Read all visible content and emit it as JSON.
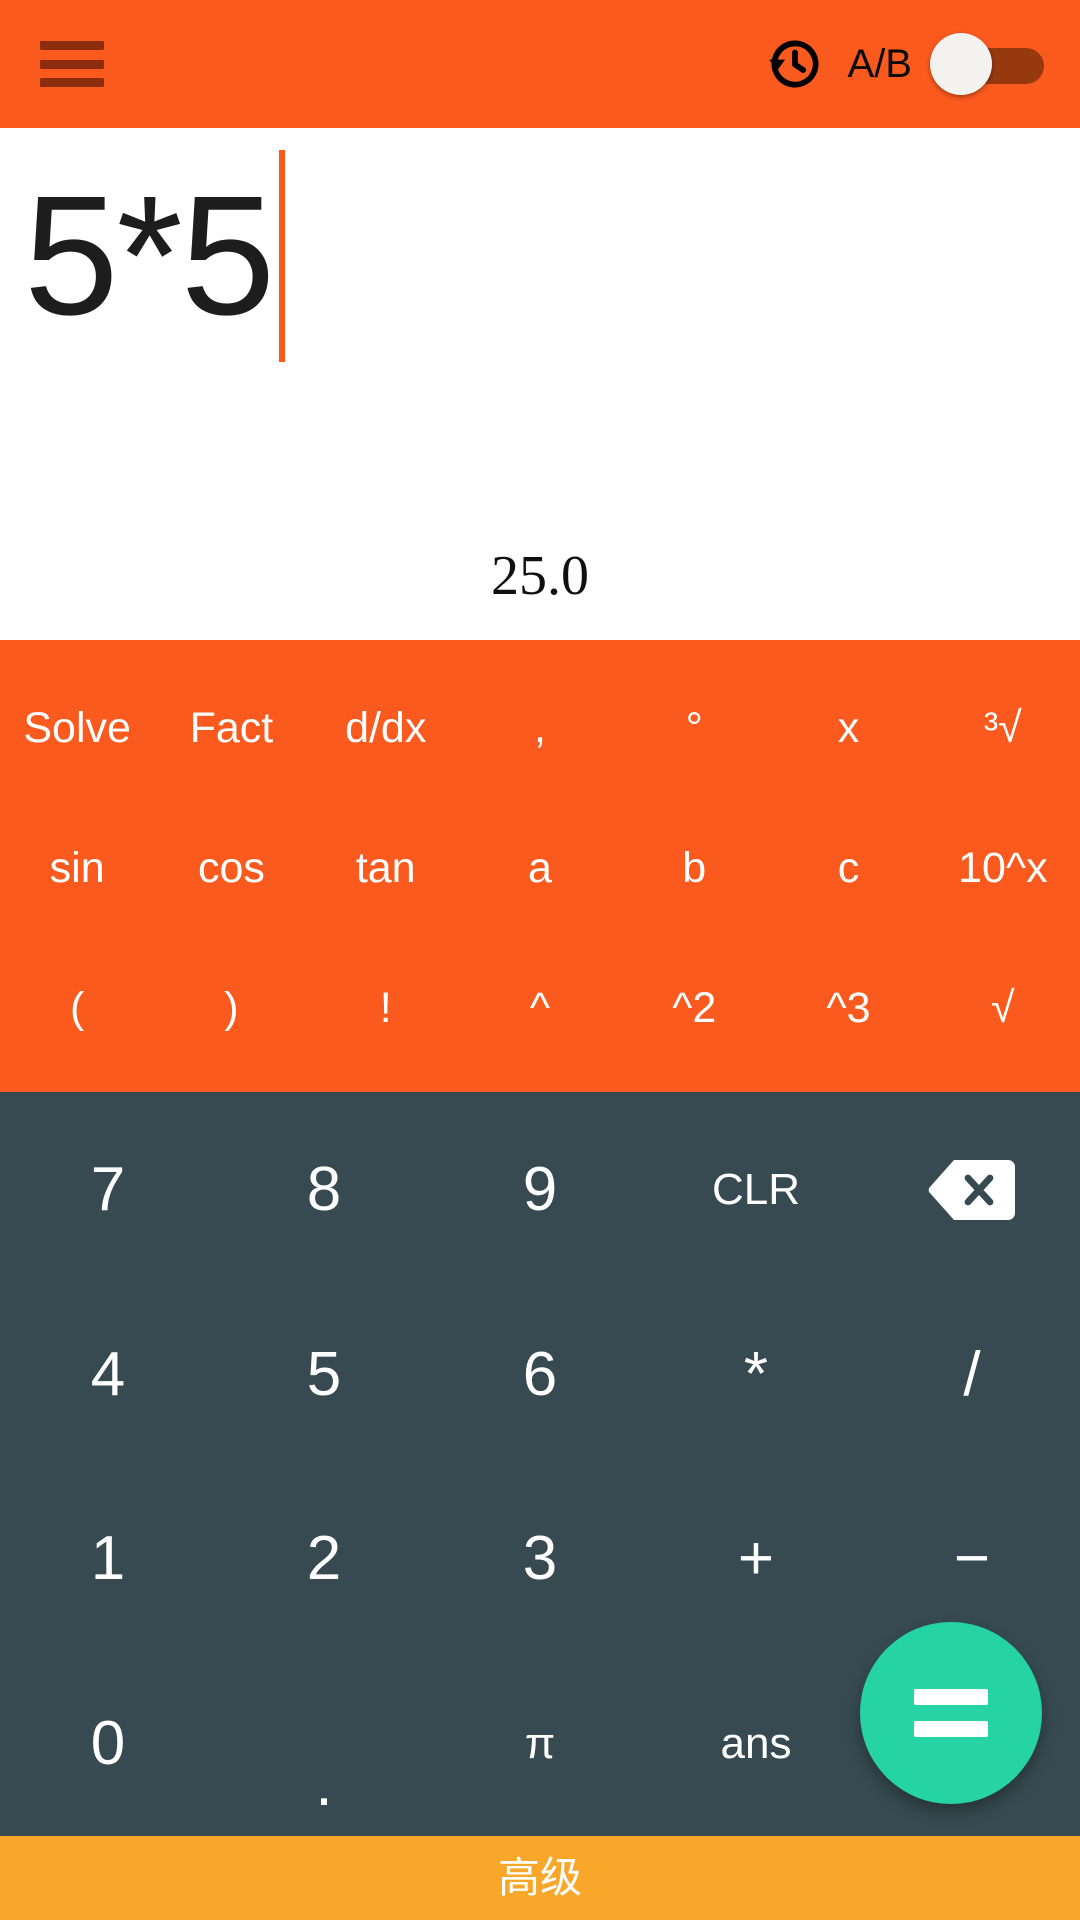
{
  "appbar": {
    "menu_icon": "hamburger-menu-icon",
    "history_icon": "history-clock-icon",
    "ab_label": "A/B",
    "ab_toggle_state": "off",
    "background_color": "#FA5A1E",
    "menu_icon_color": "#8C2D10"
  },
  "display": {
    "expression": "5*5",
    "result": "25.0",
    "caret_color": "#FA5A1E",
    "background_color": "#FFFFFF"
  },
  "funcpad": {
    "background_color": "#FA5A1E",
    "rows": [
      [
        {
          "label": "Solve",
          "name": "solve"
        },
        {
          "label": "Fact",
          "name": "fact"
        },
        {
          "label": "d/dx",
          "name": "ddx"
        },
        {
          "label": ",",
          "name": "comma"
        },
        {
          "label": "°",
          "name": "degree"
        },
        {
          "label": "x",
          "name": "variable-x"
        },
        {
          "label": "³√",
          "name": "cube-root"
        }
      ],
      [
        {
          "label": "sin",
          "name": "sin"
        },
        {
          "label": "cos",
          "name": "cos"
        },
        {
          "label": "tan",
          "name": "tan"
        },
        {
          "label": "a",
          "name": "variable-a"
        },
        {
          "label": "b",
          "name": "variable-b"
        },
        {
          "label": "c",
          "name": "variable-c"
        },
        {
          "label": "10^x",
          "name": "ten-power-x"
        }
      ],
      [
        {
          "label": "(",
          "name": "open-paren"
        },
        {
          "label": ")",
          "name": "close-paren"
        },
        {
          "label": "!",
          "name": "factorial"
        },
        {
          "label": "^",
          "name": "power"
        },
        {
          "label": "^2",
          "name": "square"
        },
        {
          "label": "^3",
          "name": "cube"
        },
        {
          "label": "√",
          "name": "square-root"
        }
      ]
    ]
  },
  "numpad": {
    "background_color": "#374A52",
    "rows": [
      [
        {
          "label": "7",
          "name": "digit-7",
          "type": "text"
        },
        {
          "label": "8",
          "name": "digit-8",
          "type": "text"
        },
        {
          "label": "9",
          "name": "digit-9",
          "type": "text"
        },
        {
          "label": "CLR",
          "name": "clear",
          "type": "small"
        },
        {
          "label": "",
          "name": "backspace",
          "type": "icon"
        }
      ],
      [
        {
          "label": "4",
          "name": "digit-4",
          "type": "text"
        },
        {
          "label": "5",
          "name": "digit-5",
          "type": "text"
        },
        {
          "label": "6",
          "name": "digit-6",
          "type": "text"
        },
        {
          "label": "*",
          "name": "multiply",
          "type": "text"
        },
        {
          "label": "/",
          "name": "divide",
          "type": "text"
        }
      ],
      [
        {
          "label": "1",
          "name": "digit-1",
          "type": "text"
        },
        {
          "label": "2",
          "name": "digit-2",
          "type": "text"
        },
        {
          "label": "3",
          "name": "digit-3",
          "type": "text"
        },
        {
          "label": "+",
          "name": "plus",
          "type": "text"
        },
        {
          "label": "−",
          "name": "minus",
          "type": "text"
        }
      ],
      [
        {
          "label": "0",
          "name": "digit-0",
          "type": "text"
        },
        {
          "label": ".",
          "name": "decimal-point",
          "type": "dot"
        },
        {
          "label": "π",
          "name": "pi",
          "type": "small"
        },
        {
          "label": "ans",
          "name": "ans",
          "type": "small"
        },
        {
          "label": "",
          "name": "fab-spacer",
          "type": "blank"
        }
      ]
    ],
    "equals_label": "=",
    "equals_color": "#26D3A5"
  },
  "bottombar": {
    "label": "高级",
    "background_color": "#F9A72B"
  }
}
